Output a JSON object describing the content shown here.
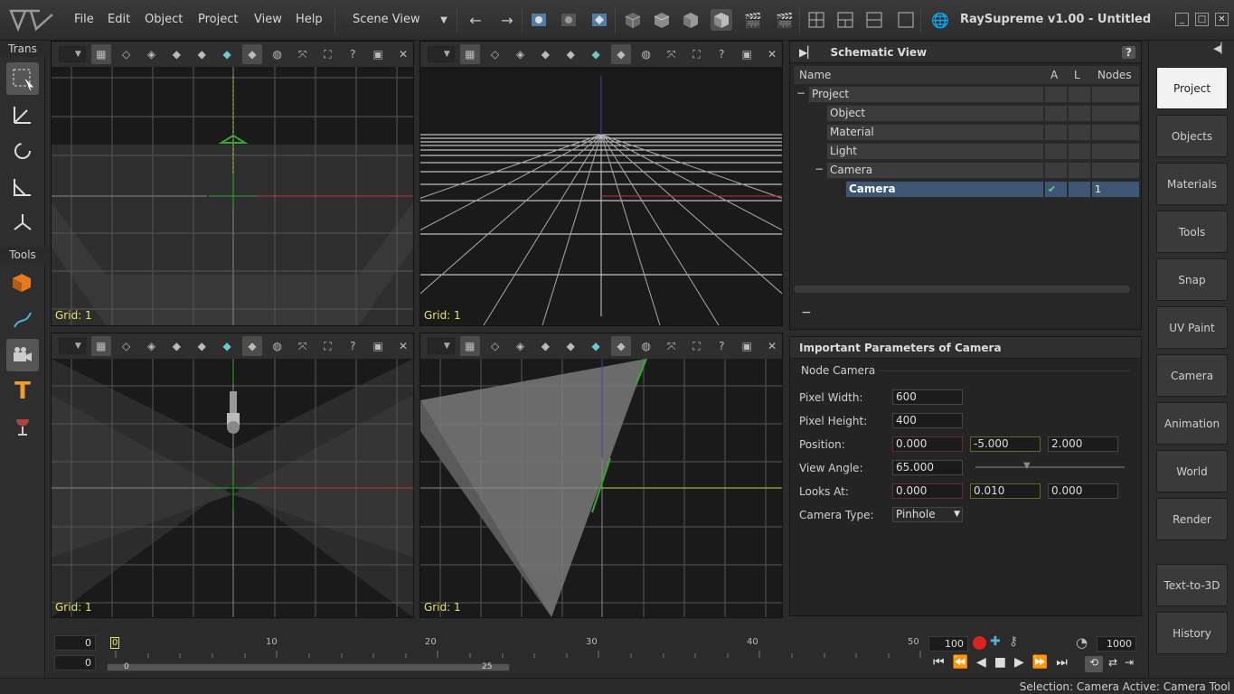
{
  "app": {
    "title": "RaySupreme v1.00 - Untitled"
  },
  "menu": [
    "File",
    "Edit",
    "Object",
    "Project",
    "View",
    "Help"
  ],
  "scene_view": {
    "label": "Scene View"
  },
  "left_tools": {
    "trans_label": "Trans",
    "tools_label": "Tools"
  },
  "viewports": [
    {
      "grid": "Grid: 1"
    },
    {
      "grid": "Grid: 1"
    },
    {
      "grid": "Grid: 1"
    },
    {
      "grid": "Grid: 1"
    }
  ],
  "schematic": {
    "title": "Schematic View",
    "help": "?",
    "columns": {
      "name": "Name",
      "a": "A",
      "l": "L",
      "nodes": "Nodes"
    },
    "rows": [
      {
        "toggle": "−",
        "label": "Project"
      },
      {
        "label": "Object"
      },
      {
        "label": "Material"
      },
      {
        "label": "Light"
      },
      {
        "toggle": "−",
        "label": "Camera"
      },
      {
        "label": "Camera",
        "a": "✔",
        "nodes": "1"
      }
    ],
    "collapse": "−"
  },
  "params": {
    "title": "Important Parameters of Camera",
    "node": "Node Camera",
    "pixel_width_label": "Pixel Width:",
    "pixel_width": "600",
    "pixel_height_label": "Pixel Height:",
    "pixel_height": "400",
    "position_label": "Position:",
    "position": [
      "0.000",
      "-5.000",
      "2.000"
    ],
    "view_angle_label": "View Angle:",
    "view_angle": "65.000",
    "looks_at_label": "Looks At:",
    "looks_at": [
      "0.000",
      "0.010",
      "0.000"
    ],
    "camera_type_label": "Camera Type:",
    "camera_type": "Pinhole"
  },
  "right_panel": [
    "Project",
    "Objects",
    "Materials",
    "Tools",
    "Snap",
    "UV Paint",
    "Camera",
    "Animation",
    "World",
    "Render",
    "Text-to-3D",
    "History"
  ],
  "timeline": {
    "start": "0",
    "current": "0",
    "ticks": [
      "0",
      "10",
      "20",
      "30",
      "40",
      "50"
    ],
    "range_start": "0",
    "range_end": "25",
    "end_frame": "100",
    "fps": "1000"
  },
  "status": "Selection: Camera  Active: Camera Tool"
}
